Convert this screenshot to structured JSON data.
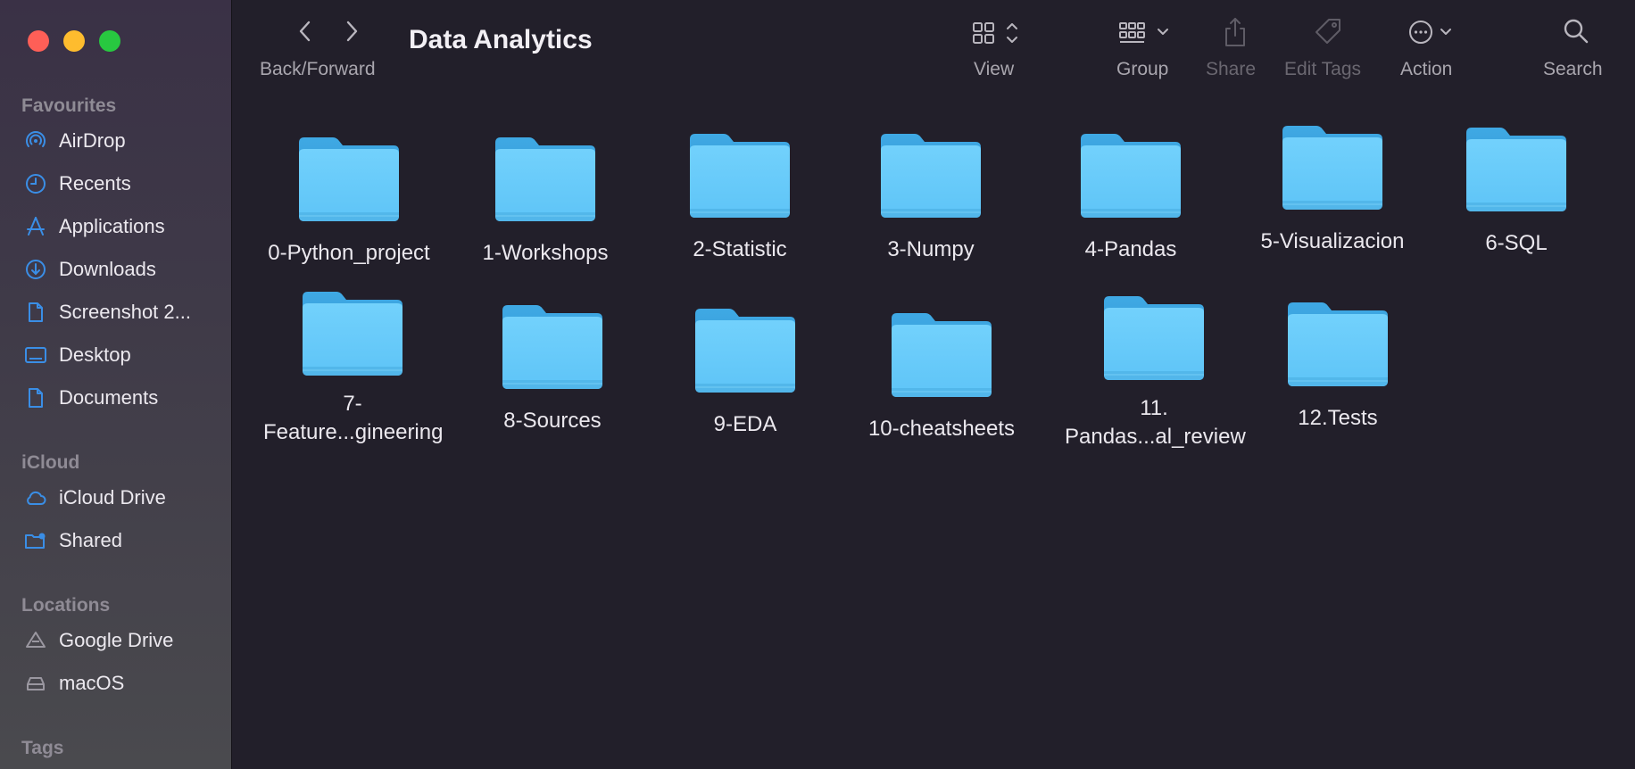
{
  "window": {
    "title": "Data Analytics"
  },
  "toolbar": {
    "back_forward_label": "Back/Forward",
    "view_label": "View",
    "group_label": "Group",
    "share_label": "Share",
    "edit_tags_label": "Edit Tags",
    "action_label": "Action",
    "search_label": "Search"
  },
  "sidebar": {
    "favourites_title": "Favourites",
    "favourites": [
      {
        "label": "AirDrop",
        "icon": "airdrop-icon"
      },
      {
        "label": "Recents",
        "icon": "clock-icon"
      },
      {
        "label": "Applications",
        "icon": "applications-icon"
      },
      {
        "label": "Downloads",
        "icon": "download-icon"
      },
      {
        "label": "Screenshot 2...",
        "icon": "document-icon"
      },
      {
        "label": "Desktop",
        "icon": "desktop-icon"
      },
      {
        "label": "Documents",
        "icon": "document-icon"
      }
    ],
    "icloud_title": "iCloud",
    "icloud": [
      {
        "label": "iCloud Drive",
        "icon": "cloud-icon"
      },
      {
        "label": "Shared",
        "icon": "shared-folder-icon"
      }
    ],
    "locations_title": "Locations",
    "locations": [
      {
        "label": "Google Drive",
        "icon": "drive-icon"
      },
      {
        "label": "macOS",
        "icon": "disk-icon"
      }
    ],
    "tags_title": "Tags"
  },
  "folders": [
    {
      "line1": "0-Python_project",
      "line2": ""
    },
    {
      "line1": "1-Workshops",
      "line2": ""
    },
    {
      "line1": "2-Statistic",
      "line2": ""
    },
    {
      "line1": "3-Numpy",
      "line2": ""
    },
    {
      "line1": "4-Pandas",
      "line2": ""
    },
    {
      "line1": "5-Visualizacion",
      "line2": ""
    },
    {
      "line1": "6-SQL",
      "line2": ""
    },
    {
      "line1": "7-",
      "line2": "Feature...gineering"
    },
    {
      "line1": "8-Sources",
      "line2": ""
    },
    {
      "line1": "9-EDA",
      "line2": ""
    },
    {
      "line1": "10-cheatsheets",
      "line2": ""
    },
    {
      "line1": "11.",
      "line2": "Pandas...al_review"
    },
    {
      "line1": "12.Tests",
      "line2": ""
    }
  ],
  "colors": {
    "folder_light": "#6ccdfb",
    "folder_dark": "#3ba6e0",
    "accent_blue": "#3a8ee6"
  }
}
